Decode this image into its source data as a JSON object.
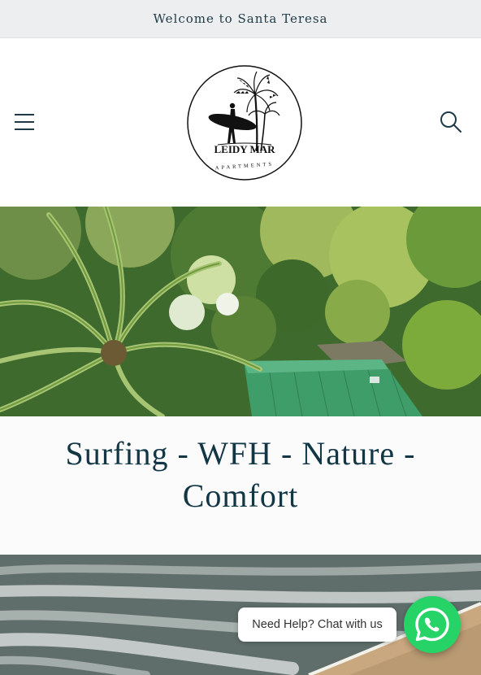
{
  "announcement": {
    "text": "Welcome to Santa Teresa"
  },
  "header": {
    "logo": {
      "name": "LEIDY MAR",
      "subtitle": "APARTMENTS"
    },
    "menu_icon": "hamburger-menu-icon",
    "search_icon": "search-icon"
  },
  "hero": {
    "image": "aerial-jungle-green-roof"
  },
  "tagline": {
    "text": "Surfing - WFH - Nature - Comfort"
  },
  "beach": {
    "image": "aerial-beach-waves"
  },
  "chat": {
    "bubble_text": "Need Help? Chat with us",
    "icon": "whatsapp-icon",
    "color": "#25d366"
  },
  "colors": {
    "announcement_bg": "#eceeef",
    "text_dark": "#123645",
    "whatsapp": "#25d366"
  }
}
